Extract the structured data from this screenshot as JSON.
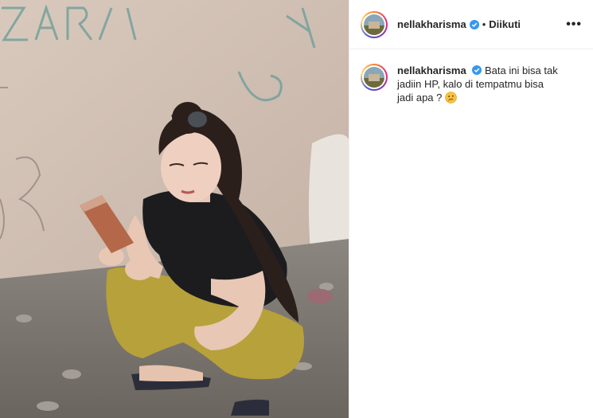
{
  "post": {
    "username": "nellakharisma",
    "follow_status": "Diikuti",
    "separator": "•",
    "more_label": "•••",
    "caption": {
      "username": "nellakharisma",
      "text": "Bata ini bisa tak jadiin HP, kalo di tempatmu bisa jadi apa ?",
      "emoji": "thinking-face"
    },
    "verified_color": "#3897f0"
  }
}
